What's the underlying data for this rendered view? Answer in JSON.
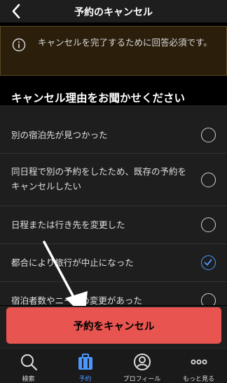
{
  "header": {
    "title": "予約のキャンセル"
  },
  "notice": {
    "text": "キャンセルを完了するために回答必須です。"
  },
  "section": {
    "title": "キャンセル理由をお聞かせください"
  },
  "reasons": [
    {
      "label": "別の宿泊先が見つかった",
      "checked": false
    },
    {
      "label": "同日程で別の予約をしたため、既存の予約をキャンセルしたい",
      "checked": false
    },
    {
      "label": "日程または行き先を変更した",
      "checked": false
    },
    {
      "label": "都合により旅行が中止になった",
      "checked": true
    },
    {
      "label": "宿泊者数やニーズの変更があった",
      "checked": false
    }
  ],
  "cta": {
    "label": "予約をキャンセル"
  },
  "tabs": [
    {
      "label": "検索",
      "icon": "search-icon",
      "active": false
    },
    {
      "label": "予約",
      "icon": "suitcase-icon",
      "active": true
    },
    {
      "label": "プロフィール",
      "icon": "profile-icon",
      "active": false
    },
    {
      "label": "もっと見る",
      "icon": "more-icon",
      "active": false
    }
  ],
  "colors": {
    "accent": "#4a98ff",
    "cta": "#e8544f",
    "notice_bg": "#2b1f0c"
  }
}
